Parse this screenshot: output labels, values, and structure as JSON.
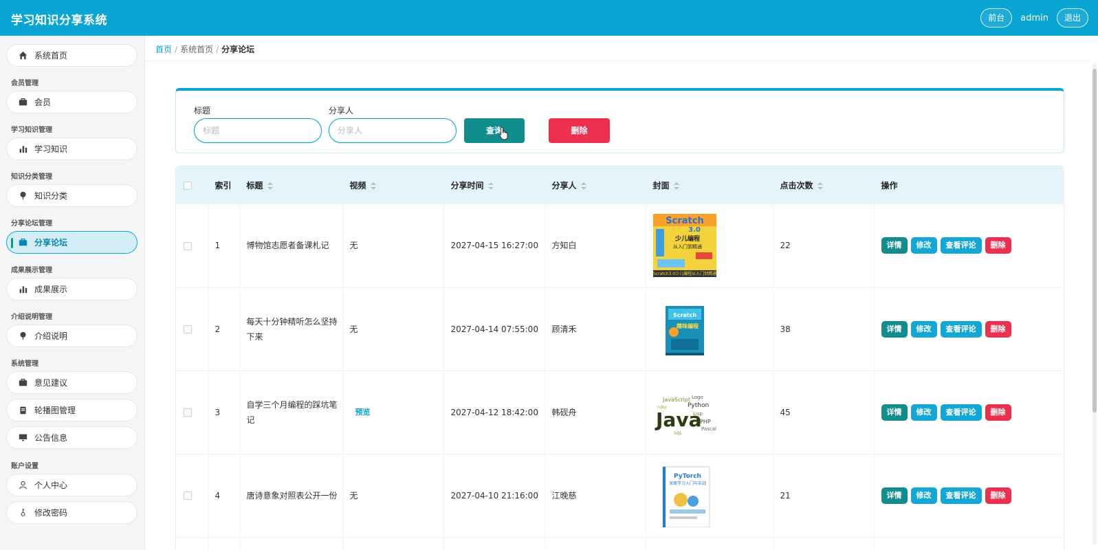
{
  "header": {
    "title": "学习知识分享系统",
    "front_label": "前台",
    "user": "admin",
    "logout_label": "退出"
  },
  "sidebar": {
    "home": "系统首页",
    "groups": [
      {
        "label": "会员管理",
        "item": "会员",
        "icon": "briefcase-icon"
      },
      {
        "label": "学习知识管理",
        "item": "学习知识",
        "icon": "bar-chart-icon"
      },
      {
        "label": "知识分类管理",
        "item": "知识分类",
        "icon": "pin-icon"
      },
      {
        "label": "分享论坛管理",
        "item": "分享论坛",
        "icon": "briefcase-icon"
      },
      {
        "label": "成果展示管理",
        "item": "成果展示",
        "icon": "bar-chart-icon"
      },
      {
        "label": "介绍说明管理",
        "item": "介绍说明",
        "icon": "pin-icon"
      }
    ],
    "system_label": "系统管理",
    "system_items": [
      "意见建议",
      "轮播图管理",
      "公告信息"
    ],
    "account_label": "账户设置",
    "account_items": [
      "个人中心",
      "修改密码"
    ],
    "active": "分享论坛"
  },
  "breadcrumb": [
    "首页",
    "系统首页",
    "分享论坛"
  ],
  "search": {
    "title_label": "标题",
    "title_placeholder": "标题",
    "sharer_label": "分享人",
    "sharer_placeholder": "分享人",
    "query_label": "查询",
    "delete_label": "删除"
  },
  "table": {
    "columns": [
      "索引",
      "标题",
      "视频",
      "分享时间",
      "分享人",
      "封面",
      "点击次数",
      "操作"
    ],
    "rows": [
      {
        "index": "1",
        "title": "博物馆志愿者备课札记",
        "video": "无",
        "time": "2027-04-15 16:27:00",
        "sharer": "方知白",
        "cover": "Scratch 3.0 少儿编程 从入门到精通",
        "clicks": "22"
      },
      {
        "index": "2",
        "title": "每天十分钟精听怎么坚持下来",
        "video": "无",
        "time": "2027-04-14 07:55:00",
        "sharer": "顾清禾",
        "cover": "Scratch 趣味编程",
        "clicks": "38"
      },
      {
        "index": "3",
        "title": "自学三个月编程的踩坑笔记",
        "video": "预览",
        "time": "2027-04-12 18:42:00",
        "sharer": "韩砚舟",
        "cover": "Java",
        "clicks": "45"
      },
      {
        "index": "4",
        "title": "唐诗意象对照表公开一份",
        "video": "无",
        "time": "2027-04-10 21:16:00",
        "sharer": "江晚慈",
        "cover": "PyTorch 深度学习入门与实战",
        "clicks": "21"
      }
    ],
    "actions": {
      "detail": "详情",
      "edit": "修改",
      "comments": "查看评论",
      "delete": "删除"
    }
  },
  "colors": {
    "primary": "#0aa5d2",
    "teal": "#118d8d",
    "danger": "#ee3050",
    "sidebar_bg": "#f3f5f7"
  }
}
